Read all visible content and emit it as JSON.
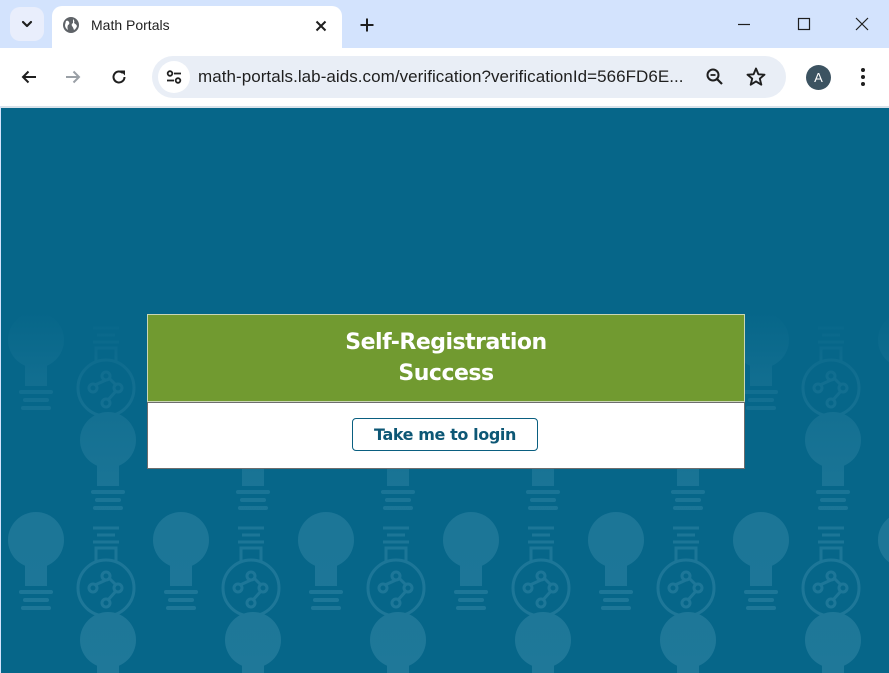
{
  "browser": {
    "tab": {
      "title": "Math Portals",
      "favicon": "globe-icon"
    },
    "new_tab_icon": "plus-icon",
    "tab_search_icon": "chevron-down-icon",
    "window_controls": [
      "minimize-icon",
      "maximize-icon",
      "close-icon"
    ],
    "toolbar": {
      "back_icon": "arrow-left-icon",
      "forward_icon": "arrow-right-icon",
      "reload_icon": "reload-icon",
      "site_info_icon": "tune-icon",
      "url": "math-portals.lab-aids.com/verification?verificationId=566FD6E...",
      "zoom_icon": "zoom-out-icon",
      "bookmark_icon": "star-icon",
      "profile_initial": "A",
      "menu_icon": "kebab-menu-icon"
    }
  },
  "page": {
    "background_pattern": "lightbulb-pattern",
    "colors": {
      "background": "#066689",
      "header": "#719a30",
      "button_text": "#0d5775"
    },
    "card": {
      "title_line1": "Self-Registration",
      "title_line2": "Success",
      "login_button": "Take me to login"
    }
  }
}
